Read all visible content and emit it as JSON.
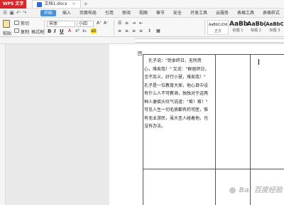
{
  "titlebar": {
    "app_name": "WPS 文字",
    "doc_tab": "文档1.docx",
    "close_glyph": "×",
    "new_tab_glyph": "+"
  },
  "menubar": {
    "items": [
      {
        "label": "开始",
        "active": true
      },
      {
        "label": "插入"
      },
      {
        "label": "页面布局"
      },
      {
        "label": "引用"
      },
      {
        "label": "审阅"
      },
      {
        "label": "视图"
      },
      {
        "label": "章节"
      },
      {
        "label": "安全"
      },
      {
        "label": "开发工具"
      },
      {
        "label": "云服务"
      },
      {
        "label": "表格工具"
      },
      {
        "label": "表格样式"
      }
    ]
  },
  "ribbon": {
    "paste_label": "粘贴",
    "cut_label": "剪切",
    "copy_label": "复制",
    "format_painter_label": "格式刷",
    "font_name": "宋体",
    "font_size": "小四",
    "bold": "B",
    "italic": "I",
    "underline": "U",
    "styles": [
      {
        "sample": "AaBbCcDd",
        "label": "正文"
      },
      {
        "sample": "AaBb",
        "label": "标题 1"
      },
      {
        "sample": "AaBb(",
        "label": "标题 2"
      },
      {
        "sample": "AaBbC",
        "label": "标题 3"
      }
    ]
  },
  "document": {
    "paragraphs": [
      "　孔子说：\"饱食终日，无所用",
      "心，难矣哉！\" 又说：\"群居终日，",
      "言不及义，好行小慧，难矣哉！\"",
      "孔子是一位教育大家，他心目中设",
      "有什么人不可教诲，独独对于这两",
      "种人便摇头叹气说道：\"难！难！\"",
      "可见人生一切毛病都有药可医，惟",
      "有无业游民，虽大圣人碰着他，也",
      "没有办法。"
    ]
  },
  "watermark": {
    "text": "Bai  百度经验"
  }
}
